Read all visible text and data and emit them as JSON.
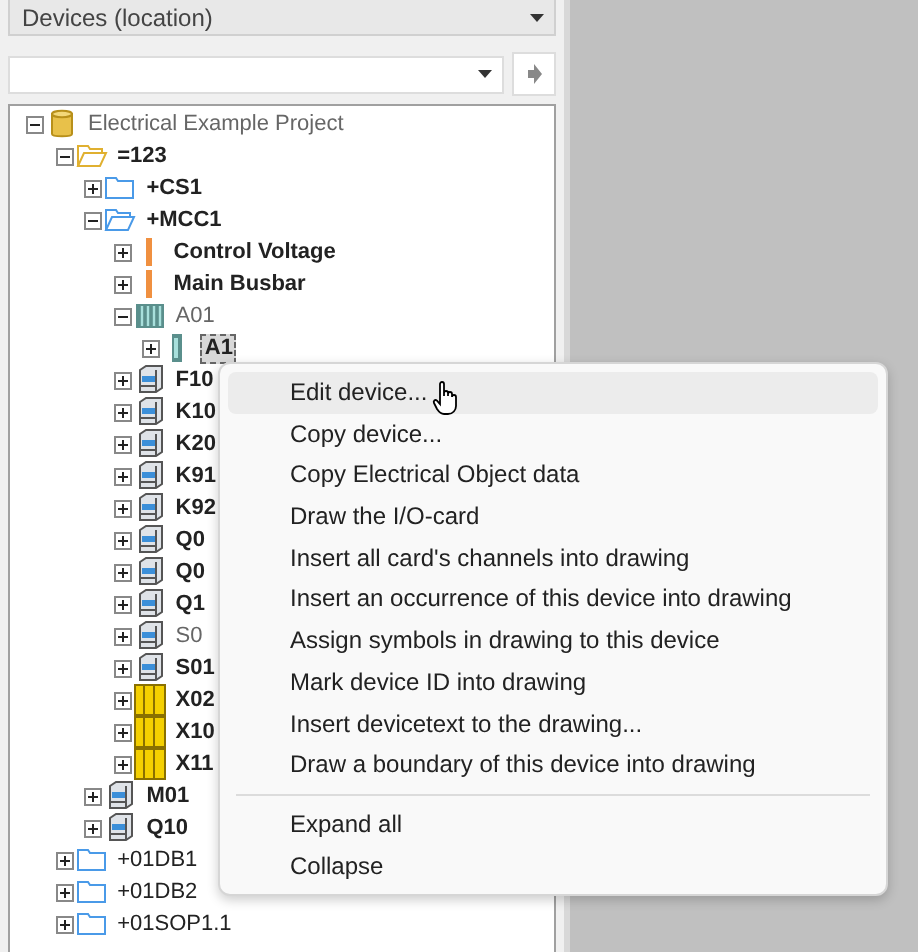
{
  "view_selector": {
    "value": "Devices (location)"
  },
  "tree": [
    {
      "label": "Electrical Example Project",
      "kind": "database",
      "bold": false,
      "muted": true,
      "expanded": true,
      "selected": false,
      "children": [
        {
          "label": "=123",
          "kind": "function-folder",
          "bold": true,
          "muted": false,
          "expanded": true,
          "selected": false,
          "children": [
            {
              "label": "+CS1",
              "kind": "location-folder",
              "bold": true,
              "muted": false,
              "expanded": false,
              "selected": false
            },
            {
              "label": "+MCC1",
              "kind": "location-folder",
              "bold": true,
              "muted": false,
              "expanded": true,
              "selected": false,
              "children": [
                {
                  "label": "Control Voltage",
                  "kind": "bus",
                  "bold": true,
                  "muted": false,
                  "expanded": false,
                  "selected": false
                },
                {
                  "label": "Main Busbar",
                  "kind": "bus",
                  "bold": true,
                  "muted": false,
                  "expanded": false,
                  "selected": false
                },
                {
                  "label": "A01",
                  "kind": "rack",
                  "bold": false,
                  "muted": true,
                  "expanded": true,
                  "selected": false,
                  "children": [
                    {
                      "label": "A1",
                      "kind": "card",
                      "bold": true,
                      "muted": false,
                      "expanded": false,
                      "selected": true
                    }
                  ]
                },
                {
                  "label": "F10",
                  "kind": "device",
                  "bold": true,
                  "muted": false,
                  "expanded": false,
                  "selected": false
                },
                {
                  "label": "K10",
                  "kind": "device",
                  "bold": true,
                  "muted": false,
                  "expanded": false,
                  "selected": false
                },
                {
                  "label": "K20",
                  "kind": "device",
                  "bold": true,
                  "muted": false,
                  "expanded": false,
                  "selected": false
                },
                {
                  "label": "K91",
                  "kind": "device",
                  "bold": true,
                  "muted": false,
                  "expanded": false,
                  "selected": false
                },
                {
                  "label": "K92",
                  "kind": "device",
                  "bold": true,
                  "muted": false,
                  "expanded": false,
                  "selected": false
                },
                {
                  "label": "Q0",
                  "kind": "device",
                  "bold": true,
                  "muted": false,
                  "expanded": false,
                  "selected": false
                },
                {
                  "label": "Q0",
                  "kind": "device",
                  "bold": true,
                  "muted": false,
                  "expanded": false,
                  "selected": false
                },
                {
                  "label": "Q1",
                  "kind": "device",
                  "bold": true,
                  "muted": false,
                  "expanded": false,
                  "selected": false
                },
                {
                  "label": "S0",
                  "kind": "device",
                  "bold": false,
                  "muted": true,
                  "expanded": false,
                  "selected": false
                },
                {
                  "label": "S01",
                  "kind": "device",
                  "bold": true,
                  "muted": false,
                  "expanded": false,
                  "selected": false
                },
                {
                  "label": "X02",
                  "kind": "terminal",
                  "bold": true,
                  "muted": false,
                  "expanded": false,
                  "selected": false
                },
                {
                  "label": "X10",
                  "kind": "terminal",
                  "bold": true,
                  "muted": false,
                  "expanded": false,
                  "selected": false
                },
                {
                  "label": "X11",
                  "kind": "terminal",
                  "bold": true,
                  "muted": false,
                  "expanded": false,
                  "selected": false
                }
              ]
            },
            {
              "label": "M01",
              "kind": "device",
              "bold": true,
              "muted": false,
              "expanded": false,
              "selected": false
            },
            {
              "label": "Q10",
              "kind": "device",
              "bold": true,
              "muted": false,
              "expanded": false,
              "selected": false
            }
          ]
        },
        {
          "label": "+01DB1",
          "kind": "location-folder",
          "bold": false,
          "muted": false,
          "expanded": false,
          "selected": false
        },
        {
          "label": "+01DB2",
          "kind": "location-folder",
          "bold": false,
          "muted": false,
          "expanded": false,
          "selected": false
        },
        {
          "label": "+01SOP1.1",
          "kind": "location-folder",
          "bold": false,
          "muted": false,
          "expanded": false,
          "selected": false
        }
      ]
    }
  ],
  "context_menu": {
    "items": [
      {
        "kind": "item",
        "label": "Edit device...",
        "selected": true
      },
      {
        "kind": "item",
        "label": "Copy device...",
        "selected": false
      },
      {
        "kind": "item",
        "label": "Copy Electrical Object data",
        "selected": false
      },
      {
        "kind": "item",
        "label": "Draw the I/O-card",
        "selected": false
      },
      {
        "kind": "item",
        "label": "Insert all card's channels into drawing",
        "selected": false
      },
      {
        "kind": "item",
        "label": "Insert an occurrence of this device into drawing",
        "selected": false
      },
      {
        "kind": "item",
        "label": "Assign symbols in drawing to this device",
        "selected": false
      },
      {
        "kind": "item",
        "label": "Mark device ID into drawing",
        "selected": false
      },
      {
        "kind": "item",
        "label": "Insert devicetext to the drawing...",
        "selected": false
      },
      {
        "kind": "item",
        "label": "Draw a boundary of this device into drawing",
        "selected": false
      },
      {
        "kind": "separator"
      },
      {
        "kind": "item",
        "label": "Expand all",
        "selected": false
      },
      {
        "kind": "item",
        "label": "Collapse",
        "selected": false
      }
    ]
  }
}
